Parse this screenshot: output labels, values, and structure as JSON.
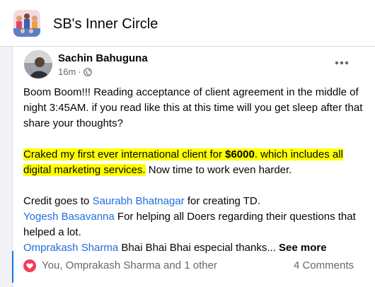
{
  "group": {
    "title": "SB's Inner Circle",
    "avatar_icon": "group-photo-icon"
  },
  "post": {
    "author": "Sachin Bahuguna",
    "time": "16m",
    "separator": "·",
    "audience_icon": "globe-icon",
    "more_icon": "more-horizontal-icon",
    "paragraph1": "Boom Boom!!! Reading acceptance of client agreement in the middle of night 3:45AM. if you read like this at this time will you get sleep after that share your thoughts?",
    "highlight_part1": "Craked my first ever international client for ",
    "highlight_amount": "$6000",
    "highlight_part2": ". which includes all digital marketing services.",
    "paragraph2_tail": " Now time to work even harder.",
    "credit_prefix": "Credit goes to ",
    "credit_name": "Saurabh Bhatnagar",
    "credit_suffix": " for creating TD.",
    "mention2_name": "Yogesh Basavanna",
    "mention2_text": " For helping all Doers regarding their questions that helped a lot.",
    "mention3_name": "Omprakash Sharma",
    "mention3_text": " Bhai Bhai Bhai especial thanks... ",
    "see_more": "See more"
  },
  "footer": {
    "reaction_icon": "heart-reaction-icon",
    "reactions_text": "You, Omprakash Sharma and 1 other",
    "comments_text": "4 Comments"
  },
  "colors": {
    "link": "#216fdb",
    "highlight": "#ffff00",
    "heart": "#f33e58",
    "accent_bar": "#1b74e4"
  }
}
